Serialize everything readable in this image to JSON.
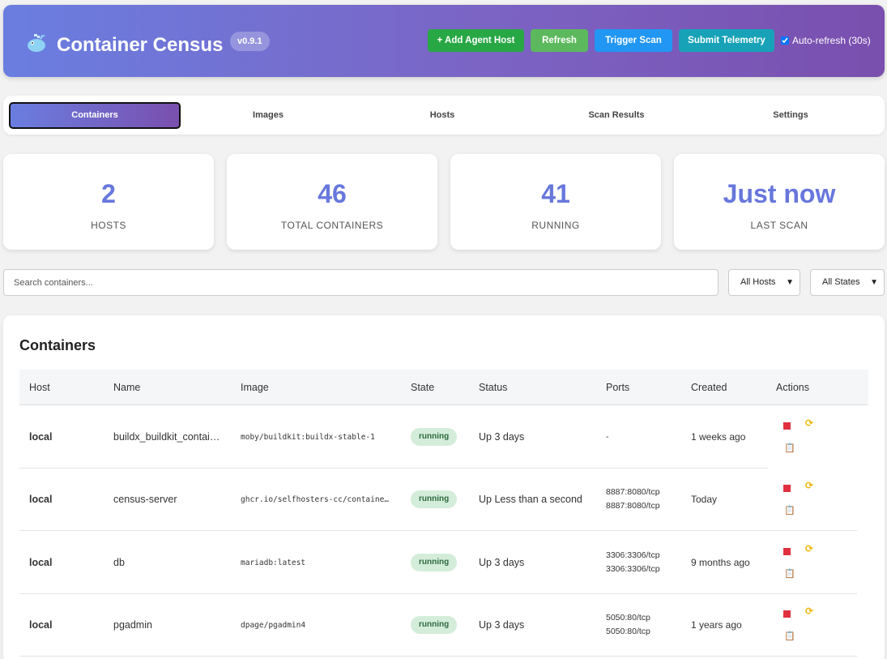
{
  "app": {
    "title": "Container Census",
    "version": "v0.9.1",
    "logo_icon": "whale-icon"
  },
  "header_actions": {
    "add_agent_host": "+ Add Agent Host",
    "refresh": "Refresh",
    "trigger_scan": "Trigger Scan",
    "submit_telemetry": "Submit Telemetry",
    "auto_refresh_label": "Auto-refresh (30s)",
    "auto_refresh_checked": true
  },
  "tabs": [
    {
      "label": "Containers",
      "active": true
    },
    {
      "label": "Images",
      "active": false
    },
    {
      "label": "Hosts",
      "active": false
    },
    {
      "label": "Scan Results",
      "active": false
    },
    {
      "label": "Settings",
      "active": false
    }
  ],
  "stats": [
    {
      "value": "2",
      "label": "HOSTS"
    },
    {
      "value": "46",
      "label": "TOTAL CONTAINERS"
    },
    {
      "value": "41",
      "label": "RUNNING"
    },
    {
      "value": "Just now",
      "label": "LAST SCAN"
    }
  ],
  "filters": {
    "search_placeholder": "Search containers...",
    "hosts_selected": "All Hosts",
    "states_selected": "All States"
  },
  "table": {
    "title": "Containers",
    "columns": [
      "Host",
      "Name",
      "Image",
      "State",
      "Status",
      "Ports",
      "Created",
      "Actions"
    ],
    "rows": [
      {
        "host": "local",
        "name": "buildx_buildkit_container",
        "image": "moby/buildkit:buildx-stable-1",
        "state": "running",
        "status": "Up 3 days",
        "ports": [
          "-"
        ],
        "created": "1 weeks ago"
      },
      {
        "host": "local",
        "name": "census-server",
        "image": "ghcr.io/selfhosters-cc/container-census",
        "state": "running",
        "status": "Up Less than a second",
        "ports": [
          "8887:8080/tcp",
          "8887:8080/tcp"
        ],
        "created": "Today"
      },
      {
        "host": "local",
        "name": "db",
        "image": "mariadb:latest",
        "state": "running",
        "status": "Up 3 days",
        "ports": [
          "3306:3306/tcp",
          "3306:3306/tcp"
        ],
        "created": "9 months ago"
      },
      {
        "host": "local",
        "name": "pgadmin",
        "image": "dpage/pgadmin4",
        "state": "running",
        "status": "Up 3 days",
        "ports": [
          "5050:80/tcp",
          "5050:80/tcp"
        ],
        "created": "1 years ago"
      }
    ]
  },
  "icons": {
    "stop": "stop-icon",
    "restart": "restart-icon",
    "logs": "logs-icon"
  },
  "colors": {
    "accent": "#6777dc",
    "running_badge_bg": "#d4edda",
    "add_button": "#28a745",
    "refresh_button": "#5cb85c",
    "scan_button": "#2196f3",
    "telemetry_button": "#17a2b8",
    "stop_icon": "#e03040",
    "restart_icon": "#f0b400"
  }
}
